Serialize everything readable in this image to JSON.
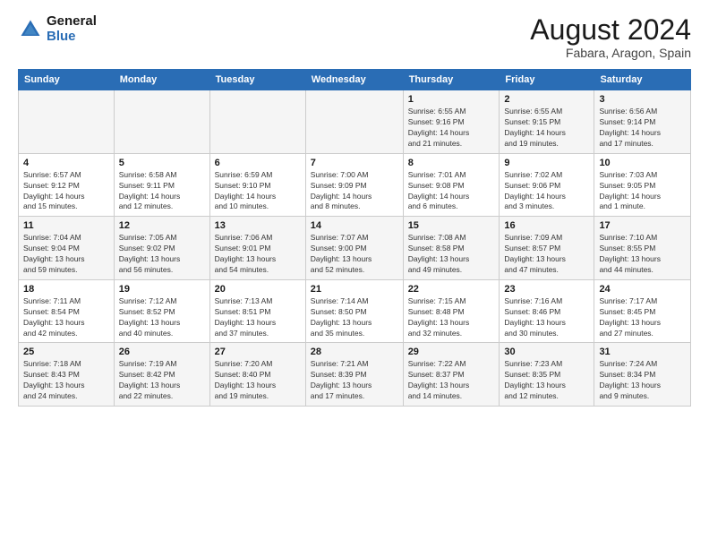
{
  "logo": {
    "line1": "General",
    "line2": "Blue"
  },
  "title": "August 2024",
  "subtitle": "Fabara, Aragon, Spain",
  "days_header": [
    "Sunday",
    "Monday",
    "Tuesday",
    "Wednesday",
    "Thursday",
    "Friday",
    "Saturday"
  ],
  "weeks": [
    [
      {
        "num": "",
        "info": ""
      },
      {
        "num": "",
        "info": ""
      },
      {
        "num": "",
        "info": ""
      },
      {
        "num": "",
        "info": ""
      },
      {
        "num": "1",
        "info": "Sunrise: 6:55 AM\nSunset: 9:16 PM\nDaylight: 14 hours\nand 21 minutes."
      },
      {
        "num": "2",
        "info": "Sunrise: 6:55 AM\nSunset: 9:15 PM\nDaylight: 14 hours\nand 19 minutes."
      },
      {
        "num": "3",
        "info": "Sunrise: 6:56 AM\nSunset: 9:14 PM\nDaylight: 14 hours\nand 17 minutes."
      }
    ],
    [
      {
        "num": "4",
        "info": "Sunrise: 6:57 AM\nSunset: 9:12 PM\nDaylight: 14 hours\nand 15 minutes."
      },
      {
        "num": "5",
        "info": "Sunrise: 6:58 AM\nSunset: 9:11 PM\nDaylight: 14 hours\nand 12 minutes."
      },
      {
        "num": "6",
        "info": "Sunrise: 6:59 AM\nSunset: 9:10 PM\nDaylight: 14 hours\nand 10 minutes."
      },
      {
        "num": "7",
        "info": "Sunrise: 7:00 AM\nSunset: 9:09 PM\nDaylight: 14 hours\nand 8 minutes."
      },
      {
        "num": "8",
        "info": "Sunrise: 7:01 AM\nSunset: 9:08 PM\nDaylight: 14 hours\nand 6 minutes."
      },
      {
        "num": "9",
        "info": "Sunrise: 7:02 AM\nSunset: 9:06 PM\nDaylight: 14 hours\nand 3 minutes."
      },
      {
        "num": "10",
        "info": "Sunrise: 7:03 AM\nSunset: 9:05 PM\nDaylight: 14 hours\nand 1 minute."
      }
    ],
    [
      {
        "num": "11",
        "info": "Sunrise: 7:04 AM\nSunset: 9:04 PM\nDaylight: 13 hours\nand 59 minutes."
      },
      {
        "num": "12",
        "info": "Sunrise: 7:05 AM\nSunset: 9:02 PM\nDaylight: 13 hours\nand 56 minutes."
      },
      {
        "num": "13",
        "info": "Sunrise: 7:06 AM\nSunset: 9:01 PM\nDaylight: 13 hours\nand 54 minutes."
      },
      {
        "num": "14",
        "info": "Sunrise: 7:07 AM\nSunset: 9:00 PM\nDaylight: 13 hours\nand 52 minutes."
      },
      {
        "num": "15",
        "info": "Sunrise: 7:08 AM\nSunset: 8:58 PM\nDaylight: 13 hours\nand 49 minutes."
      },
      {
        "num": "16",
        "info": "Sunrise: 7:09 AM\nSunset: 8:57 PM\nDaylight: 13 hours\nand 47 minutes."
      },
      {
        "num": "17",
        "info": "Sunrise: 7:10 AM\nSunset: 8:55 PM\nDaylight: 13 hours\nand 44 minutes."
      }
    ],
    [
      {
        "num": "18",
        "info": "Sunrise: 7:11 AM\nSunset: 8:54 PM\nDaylight: 13 hours\nand 42 minutes."
      },
      {
        "num": "19",
        "info": "Sunrise: 7:12 AM\nSunset: 8:52 PM\nDaylight: 13 hours\nand 40 minutes."
      },
      {
        "num": "20",
        "info": "Sunrise: 7:13 AM\nSunset: 8:51 PM\nDaylight: 13 hours\nand 37 minutes."
      },
      {
        "num": "21",
        "info": "Sunrise: 7:14 AM\nSunset: 8:50 PM\nDaylight: 13 hours\nand 35 minutes."
      },
      {
        "num": "22",
        "info": "Sunrise: 7:15 AM\nSunset: 8:48 PM\nDaylight: 13 hours\nand 32 minutes."
      },
      {
        "num": "23",
        "info": "Sunrise: 7:16 AM\nSunset: 8:46 PM\nDaylight: 13 hours\nand 30 minutes."
      },
      {
        "num": "24",
        "info": "Sunrise: 7:17 AM\nSunset: 8:45 PM\nDaylight: 13 hours\nand 27 minutes."
      }
    ],
    [
      {
        "num": "25",
        "info": "Sunrise: 7:18 AM\nSunset: 8:43 PM\nDaylight: 13 hours\nand 24 minutes."
      },
      {
        "num": "26",
        "info": "Sunrise: 7:19 AM\nSunset: 8:42 PM\nDaylight: 13 hours\nand 22 minutes."
      },
      {
        "num": "27",
        "info": "Sunrise: 7:20 AM\nSunset: 8:40 PM\nDaylight: 13 hours\nand 19 minutes."
      },
      {
        "num": "28",
        "info": "Sunrise: 7:21 AM\nSunset: 8:39 PM\nDaylight: 13 hours\nand 17 minutes."
      },
      {
        "num": "29",
        "info": "Sunrise: 7:22 AM\nSunset: 8:37 PM\nDaylight: 13 hours\nand 14 minutes."
      },
      {
        "num": "30",
        "info": "Sunrise: 7:23 AM\nSunset: 8:35 PM\nDaylight: 13 hours\nand 12 minutes."
      },
      {
        "num": "31",
        "info": "Sunrise: 7:24 AM\nSunset: 8:34 PM\nDaylight: 13 hours\nand 9 minutes."
      }
    ]
  ]
}
